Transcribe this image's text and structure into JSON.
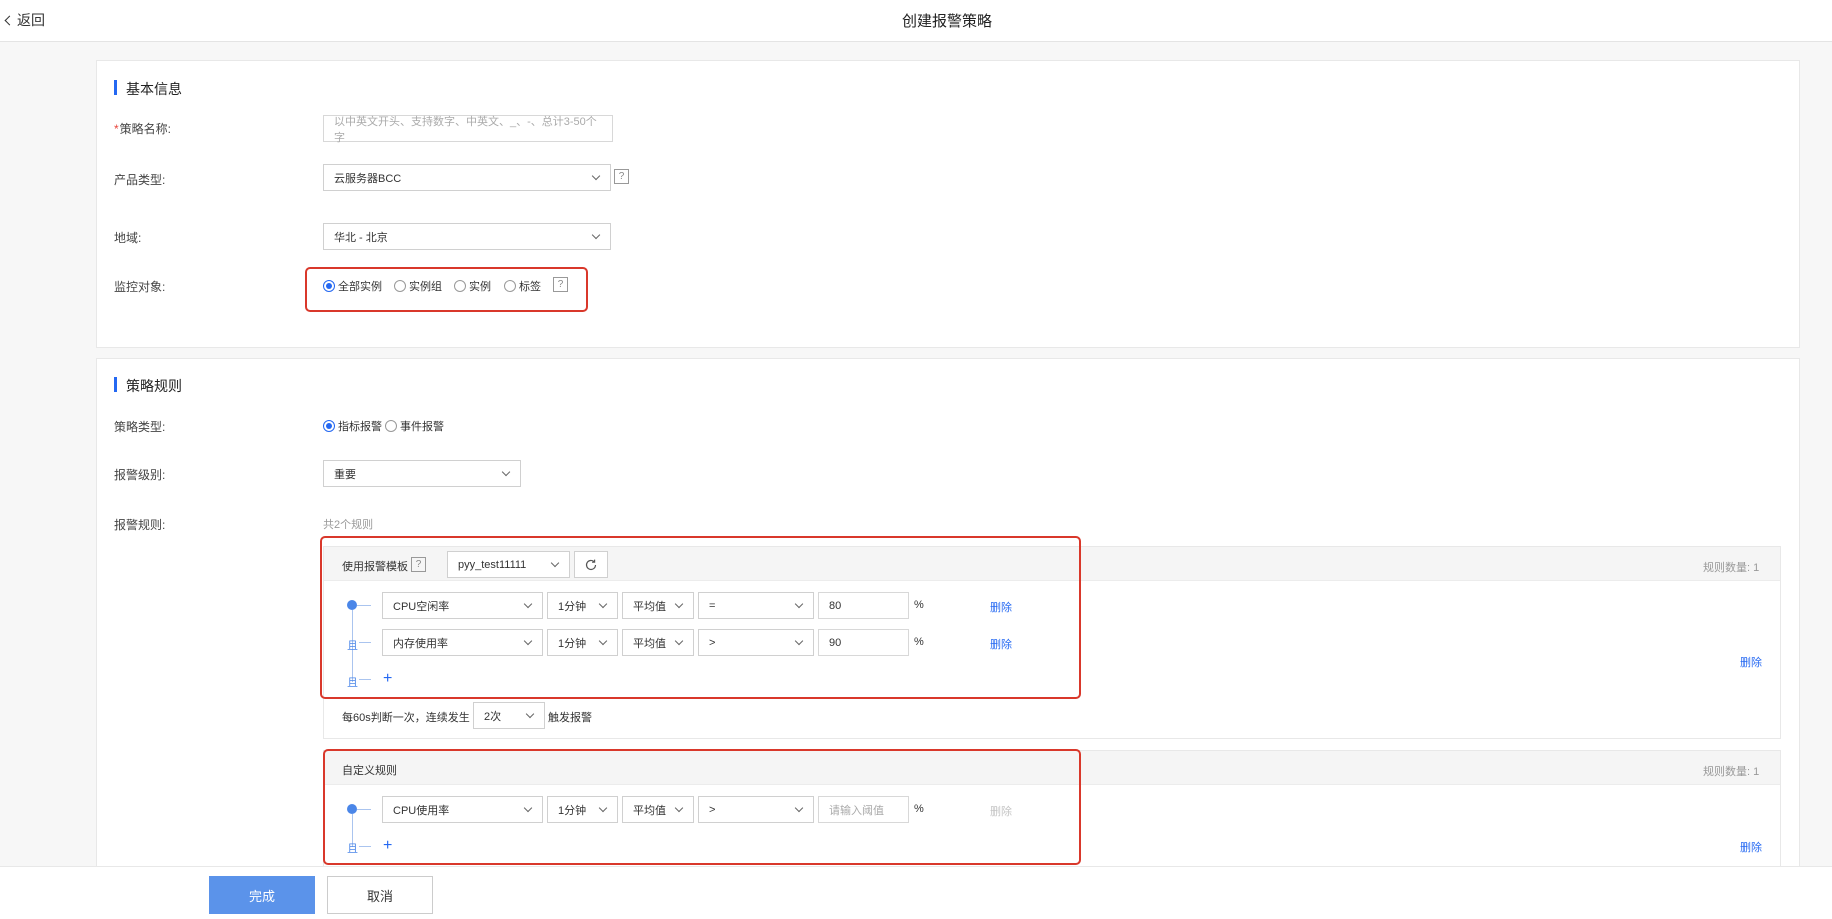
{
  "topbar": {
    "back_label": "返回",
    "title": "创建报警策略"
  },
  "basic": {
    "section_title": "基本信息",
    "name_label": "策略名称:",
    "name_placeholder": "以中英文开头、支持数字、中英文、_、-、总计3-50个字",
    "product_label": "产品类型:",
    "product_value": "云服务器BCC",
    "region_label": "地域:",
    "region_value": "华北 - 北京",
    "target_label": "监控对象:",
    "target_options": [
      "全部实例",
      "实例组",
      "实例",
      "标签"
    ],
    "target_selected": "全部实例",
    "help_glyph": "?"
  },
  "rules": {
    "section_title": "策略规则",
    "type_label": "策略类型:",
    "type_options": [
      "指标报警",
      "事件报警"
    ],
    "type_selected": "指标报警",
    "level_label": "报警级别:",
    "level_value": "重要",
    "rules_label": "报警规则:",
    "rules_total": "共2个规则",
    "template_block": {
      "title": "使用报警模板",
      "template_value": "pyy_test11111",
      "count": "规则数量: 1",
      "conditions": [
        {
          "metric": "CPU空闲率",
          "period": "1分钟",
          "stat": "平均值",
          "op": "=",
          "value": "80",
          "unit": "%",
          "delete": "删除"
        },
        {
          "metric": "内存使用率",
          "period": "1分钟",
          "stat": "平均值",
          "op": ">",
          "value": "90",
          "unit": "%",
          "delete": "删除"
        }
      ],
      "and_label": "且",
      "frequency_prefix": "每60s判断一次，连续发生",
      "frequency_value": "2次",
      "frequency_suffix": "触发报警",
      "block_delete": "删除"
    },
    "custom_block": {
      "title": "自定义规则",
      "count": "规则数量: 1",
      "conditions": [
        {
          "metric": "CPU使用率",
          "period": "1分钟",
          "stat": "平均值",
          "op": ">",
          "value_placeholder": "请输入阈值",
          "unit": "%",
          "delete": "删除"
        }
      ],
      "and_label": "且",
      "block_delete": "删除"
    }
  },
  "footer": {
    "submit": "完成",
    "cancel": "取消"
  },
  "colors": {
    "accent": "#2468f2",
    "highlight_box": "#d9382b",
    "primary_button": "#5b93ea"
  }
}
